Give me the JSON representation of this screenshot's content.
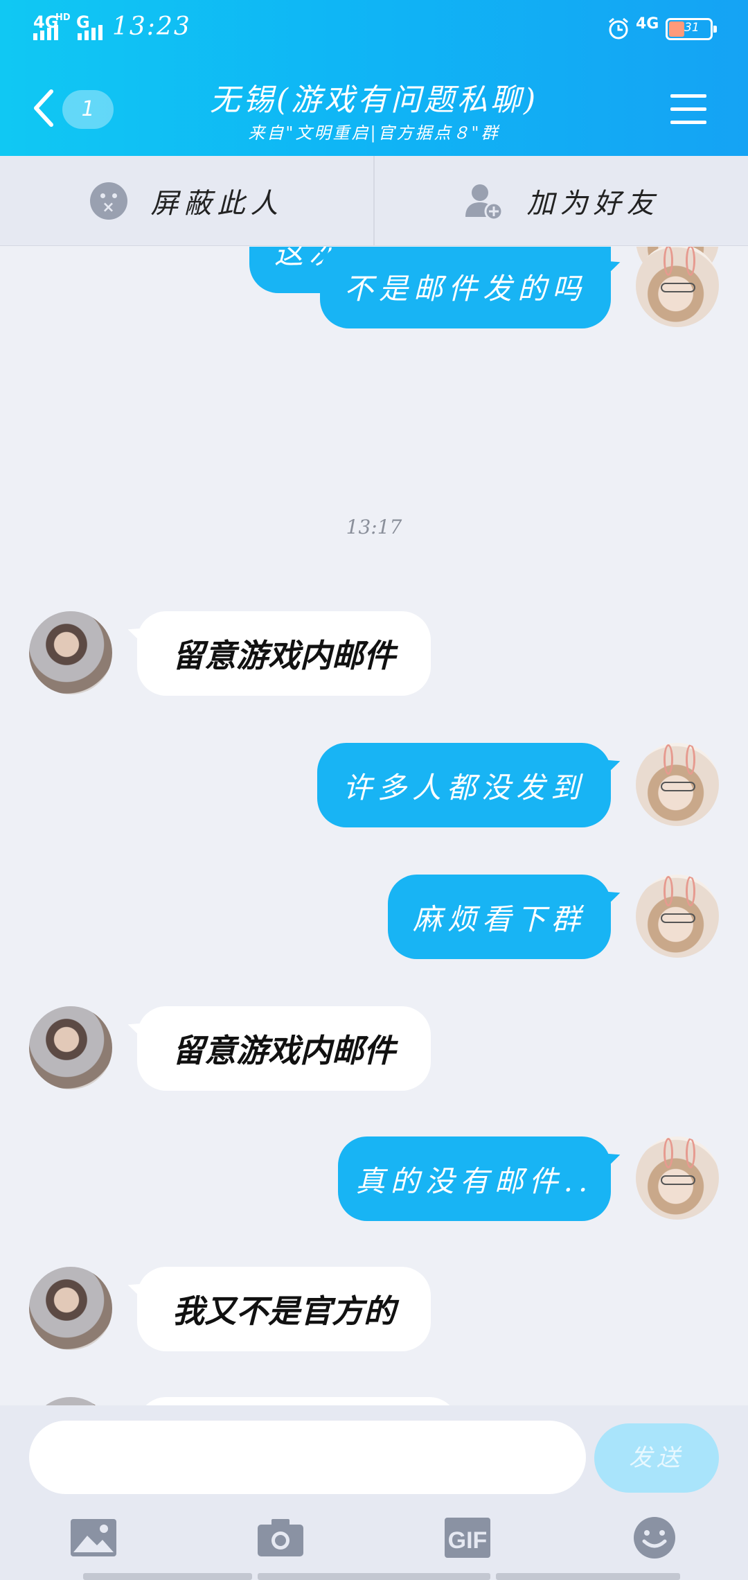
{
  "status_bar": {
    "signal1": "4G",
    "signal1_sup": "HD",
    "signal2": "G",
    "time": "13:23",
    "network": "4G",
    "battery": "31"
  },
  "header": {
    "unread_count": "1",
    "title": "无锡(游戏有问题私聊)",
    "subtitle": "来自\"文明重启|官方据点８\"群"
  },
  "actions": {
    "block_label": "屏蔽此人",
    "add_friend_label": "加为好友"
  },
  "messages": [
    {
      "side": "out",
      "text": "这次更新的奖励是啥"
    },
    {
      "side": "out",
      "text": "不是邮件发的吗"
    },
    {
      "side": "time",
      "text": "13:17"
    },
    {
      "side": "in",
      "text": "留意游戏内邮件"
    },
    {
      "side": "out",
      "text": "许多人都没发到"
    },
    {
      "side": "out",
      "text": "麻烦看下群"
    },
    {
      "side": "in",
      "text": "留意游戏内邮件"
    },
    {
      "side": "out",
      "text": "真的没有邮件.."
    },
    {
      "side": "in",
      "text": "我又不是官方的"
    }
  ],
  "composer": {
    "input_value": "",
    "send_label": "发送"
  },
  "toolbar": [
    "image-icon",
    "camera-icon",
    "gif-icon",
    "emoji-icon"
  ],
  "colors": {
    "header_start": "#10c8f3",
    "header_end": "#15a3f4",
    "bubble_out": "#18b4f4",
    "bubble_in": "#ffffff",
    "background": "#eef0f6"
  }
}
